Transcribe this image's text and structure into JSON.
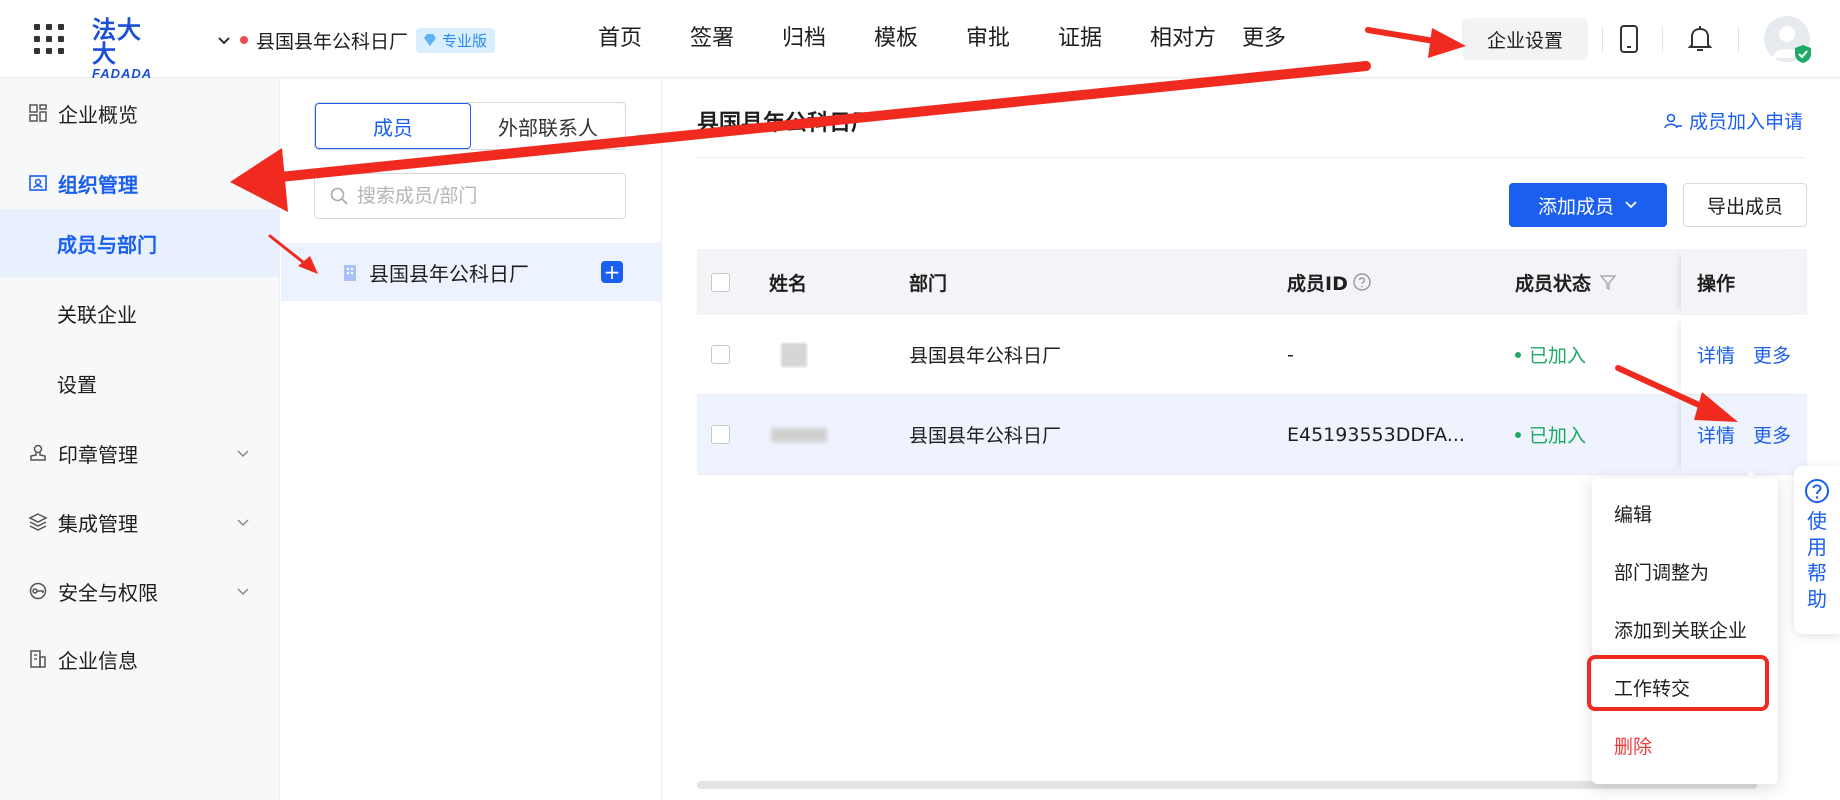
{
  "header": {
    "logo_cn": "法大大",
    "logo_en": "FADADA",
    "org_name": "县国县年公科日厂",
    "edition_badge": "专业版",
    "nav": [
      "首页",
      "签署",
      "归档",
      "模板",
      "审批",
      "证据",
      "相对方",
      "更多"
    ],
    "enterprise_settings": "企业设置"
  },
  "sidebar": {
    "items": [
      {
        "label": "企业概览"
      },
      {
        "label": "组织管理"
      },
      {
        "label": "成员与部门"
      },
      {
        "label": "关联企业"
      },
      {
        "label": "设置"
      },
      {
        "label": "印章管理"
      },
      {
        "label": "集成管理"
      },
      {
        "label": "安全与权限"
      },
      {
        "label": "企业信息"
      }
    ]
  },
  "middle": {
    "tab_members": "成员",
    "tab_external": "外部联系人",
    "search_placeholder": "搜索成员/部门",
    "tree_root": "县国县年公科日厂",
    "add_symbol": "+"
  },
  "main": {
    "title": "县国县年公科日厂",
    "apply_link": "成员加入申请",
    "add_member": "添加成员",
    "export_members": "导出成员",
    "columns": {
      "name": "姓名",
      "dept": "部门",
      "member_id": "成员ID",
      "status": "成员状态",
      "actions": "操作"
    },
    "rows": [
      {
        "dept": "县国县年公科日厂",
        "member_id": "-",
        "status": "已加入",
        "detail": "详情",
        "more": "更多"
      },
      {
        "dept": "县国县年公科日厂",
        "member_id": "E45193553DDFA...",
        "status": "已加入",
        "detail": "详情",
        "more": "更多"
      }
    ]
  },
  "dropdown": {
    "items": [
      "编辑",
      "部门调整为",
      "添加到关联企业",
      "工作转交",
      "删除"
    ]
  },
  "help_tab": {
    "chars": [
      "使",
      "用",
      "帮",
      "助"
    ]
  },
  "colors": {
    "primary": "#1a5ff0",
    "success": "#1fa866",
    "danger": "#f03c3c",
    "annotation": "#f02a1e"
  }
}
